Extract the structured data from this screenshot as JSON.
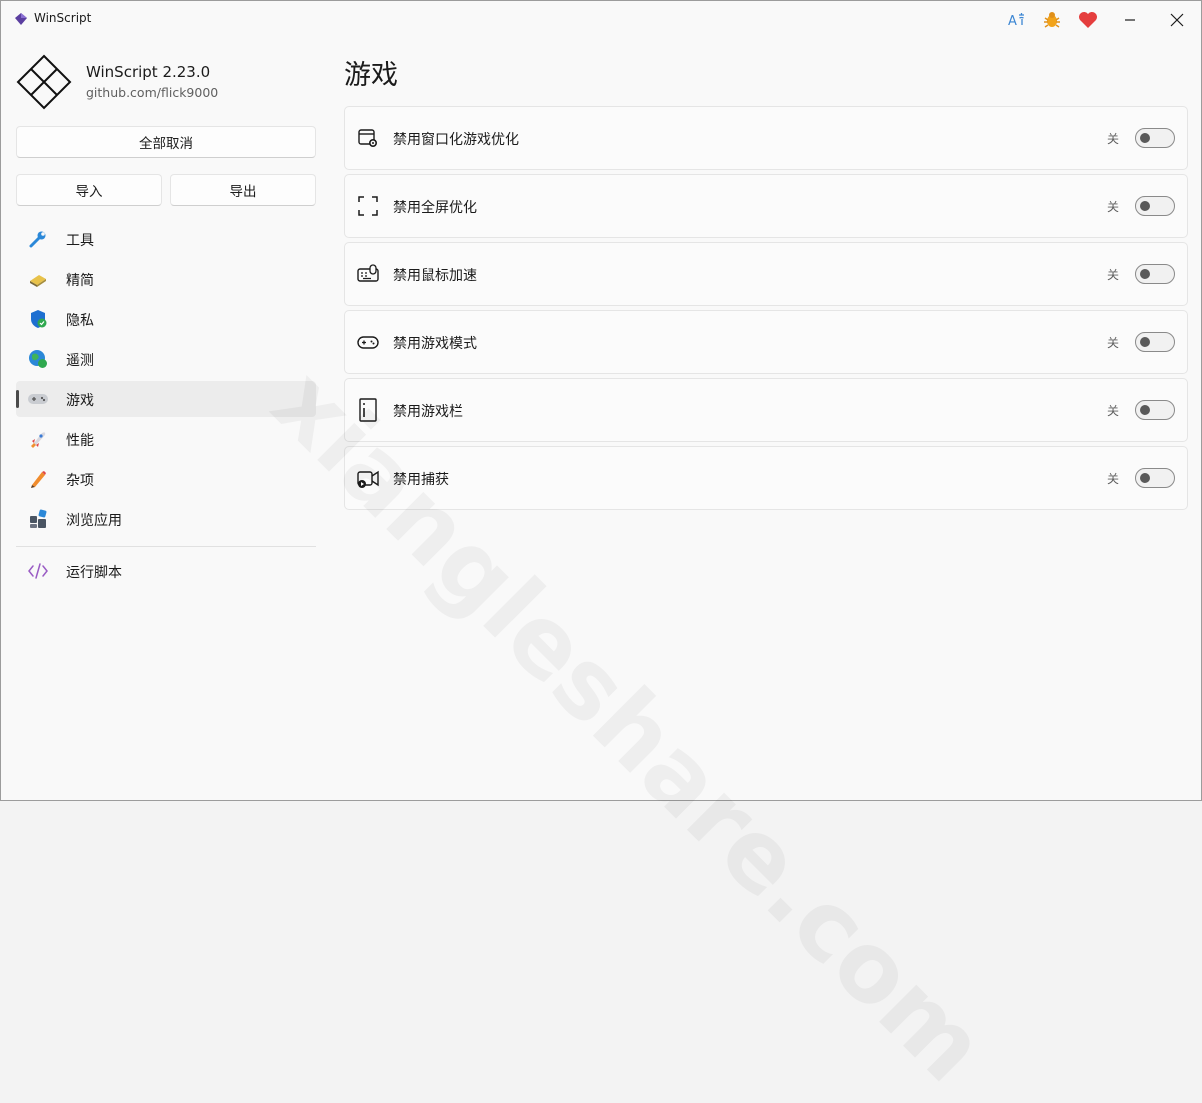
{
  "window": {
    "title": "WinScript"
  },
  "titlebar": {
    "icons": [
      "translate-icon",
      "bug-icon",
      "heart-icon"
    ],
    "controls": [
      "minimize-icon",
      "close-icon"
    ]
  },
  "brand": {
    "name": "WinScript 2.23.0",
    "url": "github.com/flick9000"
  },
  "buttons": {
    "deselect_all": "全部取消",
    "import": "导入",
    "export": "导出"
  },
  "sidebar": {
    "items": [
      {
        "label": "工具",
        "icon": "wrench-icon"
      },
      {
        "label": "精简",
        "icon": "broom-icon"
      },
      {
        "label": "隐私",
        "icon": "shield-icon"
      },
      {
        "label": "遥测",
        "icon": "globe-icon"
      },
      {
        "label": "游戏",
        "icon": "gamepad-icon",
        "active": true
      },
      {
        "label": "性能",
        "icon": "rocket-icon"
      },
      {
        "label": "杂项",
        "icon": "pencil-icon"
      },
      {
        "label": "浏览应用",
        "icon": "apps-icon"
      }
    ],
    "footer": {
      "label": "运行脚本",
      "icon": "code-icon"
    }
  },
  "main": {
    "title": "游戏",
    "settings": [
      {
        "label": "禁用窗口化游戏优化",
        "state": "关",
        "on": false,
        "icon": "window-gear-icon"
      },
      {
        "label": "禁用全屏优化",
        "state": "关",
        "on": false,
        "icon": "fullscreen-icon"
      },
      {
        "label": "禁用鼠标加速",
        "state": "关",
        "on": false,
        "icon": "keyboard-mouse-icon"
      },
      {
        "label": "禁用游戏模式",
        "state": "关",
        "on": false,
        "icon": "controller-icon"
      },
      {
        "label": "禁用游戏栏",
        "state": "关",
        "on": false,
        "icon": "gamebar-icon"
      },
      {
        "label": "禁用捕获",
        "state": "关",
        "on": false,
        "icon": "capture-icon"
      }
    ]
  },
  "watermark": "xiangleshare.com",
  "colors": {
    "accent": "#4a4a4a",
    "heart": "#e53e3e",
    "bug": "#f2a31a",
    "translate": "#3c86d3"
  }
}
